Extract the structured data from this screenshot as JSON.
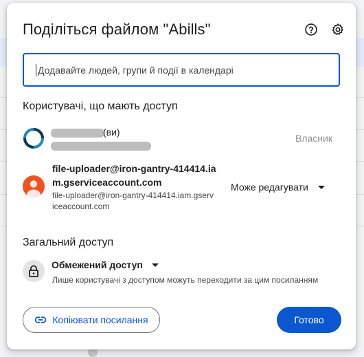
{
  "dialog": {
    "title": "Поділіться файлом \"Abills\"",
    "help_icon": "help-circle-icon",
    "settings_icon": "gear-icon"
  },
  "add_people": {
    "placeholder": "Додавайте людей, групи й події в календарі"
  },
  "people_section": {
    "title": "Користувачі, що мають доступ",
    "owner": {
      "suffix": "(ви)",
      "role": "Власник"
    },
    "service_account": {
      "name": "file-uploader@iron-gantry-414414.iam.gserviceaccount.com",
      "email": "file-uploader@iron-gantry-414414.iam.gserviceaccount.com",
      "role": "Може редагувати"
    }
  },
  "general_access": {
    "title": "Загальний доступ",
    "mode": "Обмежений доступ",
    "description": "Лише користувачі з доступом можуть переходити за цим посиланням"
  },
  "footer": {
    "copy_link": "Копіювати посилання",
    "done": "Готово"
  },
  "colors": {
    "accent": "#0b57d0",
    "avatar_service": "#f4511e"
  }
}
